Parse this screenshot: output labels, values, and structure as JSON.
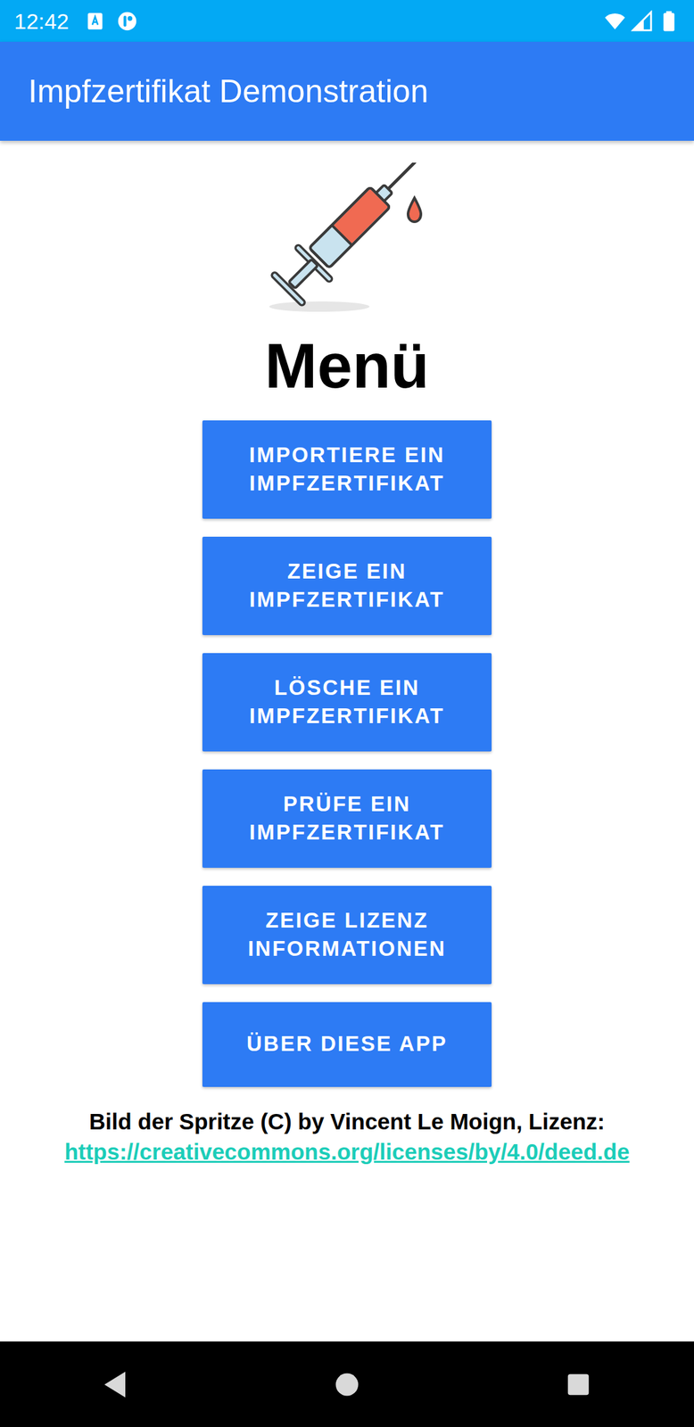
{
  "status_bar": {
    "time": "12:42"
  },
  "app_bar": {
    "title": "Impfzertifikat Demonstration"
  },
  "heading": "Menü",
  "buttons": [
    "IMPORTIERE EIN IMPFZERTIFIKAT",
    "ZEIGE EIN IMPFZERTIFIKAT",
    "LÖSCHE EIN IMPFZERTIFIKAT",
    "PRÜFE EIN IMPFZERTIFIKAT",
    "ZEIGE LIZENZ INFORMATIONEN",
    "ÜBER DIESE APP"
  ],
  "credit": {
    "text": "Bild der Spritze (C) by Vincent Le Moign, Lizenz:",
    "link": "https://creativecommons.org/licenses/by/4.0/deed.de"
  }
}
